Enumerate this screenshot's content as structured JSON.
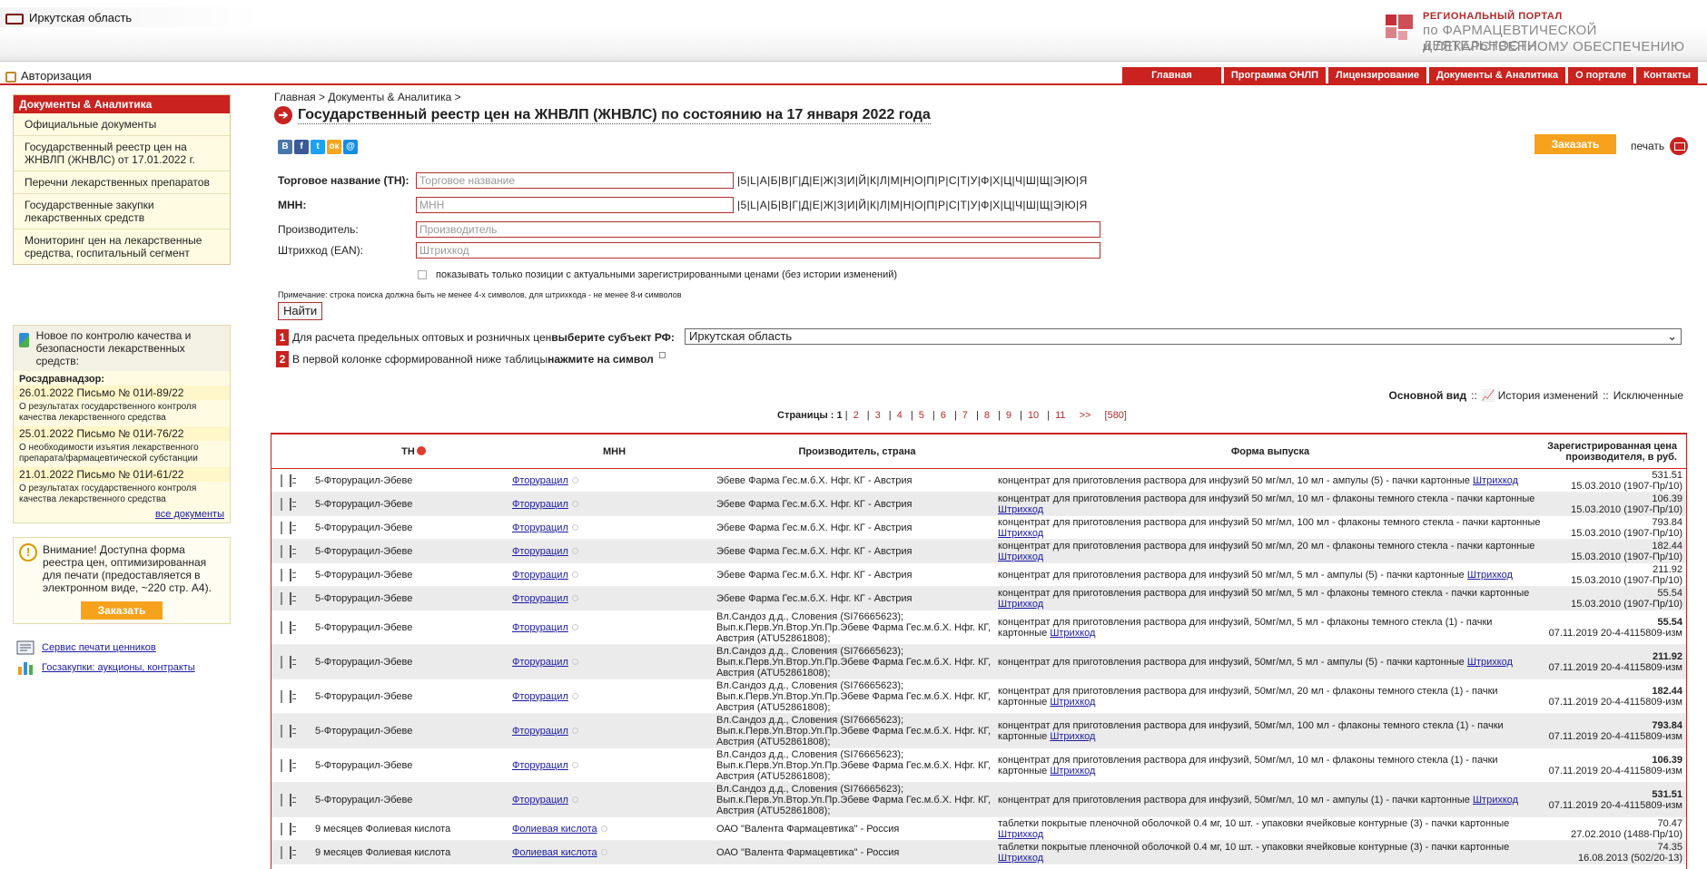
{
  "header": {
    "region": "Иркутская область",
    "portal_line1": "РЕГИОНАЛЬНЫЙ ПОРТАЛ",
    "portal_line2": "по ФАРМАЦЕВТИЧЕСКОЙ ДЕЯТЕЛЬНОСТИ",
    "portal_line3": "и ЛЕКАРСТВЕННОМУ ОБЕСПЕЧЕНИЮ"
  },
  "auth_label": "Авторизация",
  "nav": [
    "Главная",
    "Программа ОНЛП",
    "Лицензирование",
    "Документы & Аналитика",
    "О портале",
    "Контакты"
  ],
  "sidebar": {
    "docs_title": "Документы & Аналитика",
    "docs_items": [
      "Официальные документы",
      "Государственный реестр цен на ЖНВЛП (ЖНВЛС) от 17.01.2022 г.",
      "Перечни лекарственных препаратов",
      "Государственные закупки лекарственных средств",
      "Мониторинг цен на лекарственные средства, госпитальный сегмент"
    ],
    "news_title": "Новое по контролю качества и безопасности лекарственных средств:",
    "news_source": "Росздравнадзор:",
    "news": [
      {
        "date": "26.01.2022  Письмо № 01И-89/22",
        "desc": "О результатах государственного контроля качества лекарственного средства"
      },
      {
        "date": "25.01.2022  Письмо № 01И-76/22",
        "desc": "О необходимости изъятия лекарственного препарата/фармацевтической субстанции"
      },
      {
        "date": "21.01.2022  Письмо № 01И-61/22",
        "desc": "О результатах государственного контроля качества лекарственного средства"
      }
    ],
    "news_all": "все документы",
    "notice": "Внимание! Доступна форма реестра цен, оптимизированная для печати (предоставляется в электронном виде, ~220 стр. А4).",
    "notice_button": "Заказать",
    "link1": "Сервис печати ценников",
    "link2": "Госзакупки: аукционы, контракты"
  },
  "main": {
    "breadcrumb": "Главная > Документы & Аналитика >",
    "title": "Государственный реестр цен на ЖНВЛП (ЖНВЛС) по состоянию на 17 января 2022 года",
    "social": [
      "В",
      "f",
      "t",
      "ок",
      "@"
    ],
    "order_button": "Заказать",
    "print_label": "печать",
    "tn_label": "Торговое название (ТН):",
    "tn_placeholder": "Торговое название",
    "mnn_label": "МНН:",
    "mnn_placeholder": "МНН",
    "alphabet": "|5|L|А|Б|В|Г|Д|Е|Ж|З|И|Й|К|Л|М|Н|О|П|Р|С|Т|У|Ф|Х|Ц|Ч|Ш|Щ|Э|Ю|Я",
    "maker_label": "Производитель:",
    "maker_placeholder": "Производитель",
    "ean_label": "Штрихкод (EAN):",
    "ean_placeholder": "Штрихкод",
    "checkbox_label": "показывать только позиции с актуальными зарегистрированными ценами (без истории изменений)",
    "note": "Примечание: строка поиска должна быть не менее 4-х символов, для штрихкода - не менее 8-и символов",
    "find_button": "Найти",
    "step1_prefix": "Для расчета предельных оптовых и розничных цен ",
    "step1_bold": "выберите субъект РФ:",
    "step2_prefix": "В первой колонке сформированной ниже таблицы ",
    "step2_bold": "нажмите на символ",
    "region_selected": "Иркутская область",
    "view_main": "Основной вид",
    "view_history": "История изменений",
    "view_excluded": "Исключенные",
    "pages_label": "Страницы :",
    "pages": [
      "1",
      "2",
      "3",
      "4",
      "5",
      "6",
      "7",
      "8",
      "9",
      "10",
      "11",
      ">>",
      "[580]"
    ]
  },
  "table": {
    "headers": [
      "ТН",
      "МНН",
      "Производитель, страна",
      "Форма выпуска",
      "Зарегистрированная цена производителя, в руб."
    ],
    "rows": [
      {
        "tn": "5-Фторурацил-Эбеве",
        "mnn": "Фторурацил",
        "prod": "Эбеве Фарма Гес.м.б.Х. Нфг. КГ - Австрия",
        "form": "концентрат для приготовления раствора для инфузий 50 мг/мл, 10 мл - ампулы (5) - пачки картонные",
        "price": "531.51",
        "reg": "15.03.2010 (1907-Пр/10)"
      },
      {
        "tn": "5-Фторурацил-Эбеве",
        "mnn": "Фторурацил",
        "prod": "Эбеве Фарма Гес.м.б.Х. Нфг. КГ - Австрия",
        "form": "концентрат для приготовления раствора для инфузий 50 мг/мл, 10 мл - флаконы темного стекла - пачки картонные",
        "price": "106.39",
        "reg": "15.03.2010 (1907-Пр/10)"
      },
      {
        "tn": "5-Фторурацил-Эбеве",
        "mnn": "Фторурацил",
        "prod": "Эбеве Фарма Гес.м.б.Х. Нфг. КГ - Австрия",
        "form": "концентрат для приготовления раствора для инфузий 50 мг/мл, 100 мл - флаконы темного стекла - пачки картонные",
        "price": "793.84",
        "reg": "15.03.2010 (1907-Пр/10)"
      },
      {
        "tn": "5-Фторурацил-Эбеве",
        "mnn": "Фторурацил",
        "prod": "Эбеве Фарма Гес.м.б.Х. Нфг. КГ - Австрия",
        "form": "концентрат для приготовления раствора для инфузий 50 мг/мл, 20 мл - флаконы темного стекла - пачки картонные",
        "price": "182.44",
        "reg": "15.03.2010 (1907-Пр/10)"
      },
      {
        "tn": "5-Фторурацил-Эбеве",
        "mnn": "Фторурацил",
        "prod": "Эбеве Фарма Гес.м.б.Х. Нфг. КГ - Австрия",
        "form": "концентрат для приготовления раствора для инфузий 50 мг/мл, 5 мл - ампулы (5) - пачки картонные",
        "price": "211.92",
        "reg": "15.03.2010 (1907-Пр/10)"
      },
      {
        "tn": "5-Фторурацил-Эбеве",
        "mnn": "Фторурацил",
        "prod": "Эбеве Фарма Гес.м.б.Х. Нфг. КГ - Австрия",
        "form": "концентрат для приготовления раствора для инфузий 50 мг/мл, 5 мл - флаконы темного стекла - пачки картонные",
        "price": "55.54",
        "reg": "15.03.2010 (1907-Пр/10)"
      },
      {
        "tn": "5-Фторурацил-Эбеве",
        "mnn": "Фторурацил",
        "prod": "Вл.Сандоз д.д., Словения (SI76665623); Вып.к.Перв.Уп.Втор.Уп.Пр.Эбеве Фарма Гес.м.б.Х. Нфг. КГ, Австрия (ATU52861808);",
        "form": "концентрат для приготовления раствора для инфузий, 50мг/мл, 5 мл - флаконы темного стекла (1) - пачки картонные",
        "price": "55.54",
        "reg": "07.11.2019 20-4-4115809-изм"
      },
      {
        "tn": "5-Фторурацил-Эбеве",
        "mnn": "Фторурацил",
        "prod": "Вл.Сандоз д.д., Словения (SI76665623); Вып.к.Перв.Уп.Втор.Уп.Пр.Эбеве Фарма Гес.м.б.Х. Нфг. КГ, Австрия (ATU52861808);",
        "form": "концентрат для приготовления раствора для инфузий, 50мг/мл, 5 мл - ампулы (5) - пачки картонные",
        "price": "211.92",
        "reg": "07.11.2019 20-4-4115809-изм"
      },
      {
        "tn": "5-Фторурацил-Эбеве",
        "mnn": "Фторурацил",
        "prod": "Вл.Сандоз д.д., Словения (SI76665623); Вып.к.Перв.Уп.Втор.Уп.Пр.Эбеве Фарма Гес.м.б.Х. Нфг. КГ, Австрия (ATU52861808);",
        "form": "концентрат для приготовления раствора для инфузий, 50мг/мл, 20 мл - флаконы темного стекла (1) - пачки картонные",
        "price": "182.44",
        "reg": "07.11.2019 20-4-4115809-изм"
      },
      {
        "tn": "5-Фторурацил-Эбеве",
        "mnn": "Фторурацил",
        "prod": "Вл.Сандоз д.д., Словения (SI76665623); Вып.к.Перв.Уп.Втор.Уп.Пр.Эбеве Фарма Гес.м.б.Х. Нфг. КГ, Австрия (ATU52861808);",
        "form": "концентрат для приготовления раствора для инфузий, 50мг/мл, 100 мл - флаконы темного стекла (1) - пачки картонные",
        "price": "793.84",
        "reg": "07.11.2019 20-4-4115809-изм"
      },
      {
        "tn": "5-Фторурацил-Эбеве",
        "mnn": "Фторурацил",
        "prod": "Вл.Сандоз д.д., Словения (SI76665623); Вып.к.Перв.Уп.Втор.Уп.Пр.Эбеве Фарма Гес.м.б.Х. Нфг. КГ, Австрия (ATU52861808);",
        "form": "концентрат для приготовления раствора для инфузий, 50мг/мл, 10 мл - флаконы темного стекла (1) - пачки картонные",
        "price": "106.39",
        "reg": "07.11.2019 20-4-4115809-изм"
      },
      {
        "tn": "5-Фторурацил-Эбеве",
        "mnn": "Фторурацил",
        "prod": "Вл.Сандоз д.д., Словения (SI76665623); Вып.к.Перв.Уп.Втор.Уп.Пр.Эбеве Фарма Гес.м.б.Х. Нфг. КГ, Австрия (ATU52861808);",
        "form": "концентрат для приготовления раствора для инфузий, 50мг/мл, 10 мл - ампулы (1) - пачки картонные",
        "price": "531.51",
        "reg": "07.11.2019 20-4-4115809-изм"
      },
      {
        "tn": "9 месяцев Фолиевая кислота",
        "mnn": "Фолиевая кислота",
        "prod": "ОАО \"Валента Фармацевтика\" - Россия",
        "form": "таблетки покрытые пленочной оболочкой 0.4 мг, 10 шт. - упаковки ячейковые контурные (3) - пачки картонные",
        "price": "70.47",
        "reg": "27.02.2010 (1488-Пр/10)"
      },
      {
        "tn": "9 месяцев Фолиевая кислота",
        "mnn": "Фолиевая кислота",
        "prod": "ОАО \"Валента Фармацевтика\" - Россия",
        "form": "таблетки покрытые пленочной оболочкой 0.4 мг, 10 шт. - упаковки ячейковые контурные (3) - пачки картонные",
        "price": "74.35",
        "reg": "16.08.2013 (502/20-13)"
      }
    ],
    "barcode_label": "Штрихкод"
  }
}
